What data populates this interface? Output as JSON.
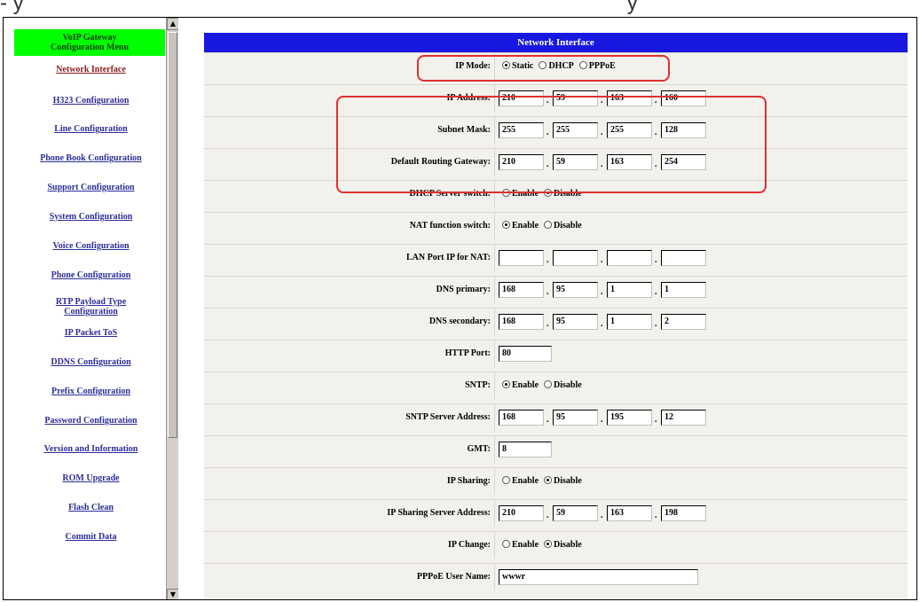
{
  "menu": {
    "header": [
      "VoIP Gateway",
      "Configuration Menu"
    ],
    "items": [
      {
        "label": "Network Interface",
        "active": true
      },
      {
        "label": "H323 Configuration"
      },
      {
        "label": "Line Configuration"
      },
      {
        "label": "Phone Book Configuration"
      },
      {
        "label": "Support Configuration"
      },
      {
        "label": "System Configuration"
      },
      {
        "label": "Voice Configuration"
      },
      {
        "label": "Phone Configuration"
      },
      {
        "label": "RTP Payload Type Configuration"
      },
      {
        "label": "IP Packet ToS"
      },
      {
        "label": "DDNS Configuration"
      },
      {
        "label": "Prefix Configuration"
      },
      {
        "label": "Password Configuration"
      },
      {
        "label": "Version and Information"
      },
      {
        "label": "ROM Upgrade"
      },
      {
        "label": "Flash Clean"
      },
      {
        "label": "Commit Data"
      }
    ]
  },
  "panel": {
    "title": "Network Interface",
    "ip_mode": {
      "label": "IP Mode:",
      "options": [
        "Static",
        "DHCP",
        "PPPoE"
      ],
      "selected": "Static"
    },
    "ip_address": {
      "label": "IP Address:",
      "octets": [
        "210",
        "59",
        "163",
        "160"
      ]
    },
    "subnet_mask": {
      "label": "Subnet Mask:",
      "octets": [
        "255",
        "255",
        "255",
        "128"
      ]
    },
    "default_gateway": {
      "label": "Default Routing Gateway:",
      "octets": [
        "210",
        "59",
        "163",
        "254"
      ]
    },
    "dhcp_server": {
      "label": "DHCP Server switch:",
      "options": [
        "Enable",
        "Disable"
      ],
      "selected": "Disable"
    },
    "nat_function": {
      "label": "NAT function switch:",
      "options": [
        "Enable",
        "Disable"
      ],
      "selected": "Enable"
    },
    "lan_port_ip": {
      "label": "LAN Port IP for NAT:",
      "octets": [
        "",
        "",
        "",
        ""
      ]
    },
    "dns_primary": {
      "label": "DNS primary:",
      "octets": [
        "168",
        "95",
        "1",
        "1"
      ]
    },
    "dns_secondary": {
      "label": "DNS secondary:",
      "octets": [
        "168",
        "95",
        "1",
        "2"
      ]
    },
    "http_port": {
      "label": "HTTP Port:",
      "value": "80"
    },
    "sntp": {
      "label": "SNTP:",
      "options": [
        "Enable",
        "Disable"
      ],
      "selected": "Enable"
    },
    "sntp_server": {
      "label": "SNTP Server Address:",
      "octets": [
        "168",
        "95",
        "195",
        "12"
      ]
    },
    "gmt": {
      "label": "GMT:",
      "value": "8"
    },
    "ip_sharing": {
      "label": "IP Sharing:",
      "options": [
        "Enable",
        "Disable"
      ],
      "selected": "Disable"
    },
    "ip_sharing_server": {
      "label": "IP Sharing Server Address:",
      "octets": [
        "210",
        "59",
        "163",
        "198"
      ]
    },
    "ip_change": {
      "label": "IP Change:",
      "options": [
        "Enable",
        "Disable"
      ],
      "selected": "Disable"
    },
    "pppoe_user": {
      "label": "PPPoE User Name:",
      "value": "wwwr"
    }
  },
  "colors": {
    "menu_header": "#00ff00",
    "title_bar": "#1818e0",
    "highlight": "#e03030"
  },
  "icons": {
    "scroll_up": "triangle-up-icon",
    "scroll_down": "triangle-down-icon"
  }
}
